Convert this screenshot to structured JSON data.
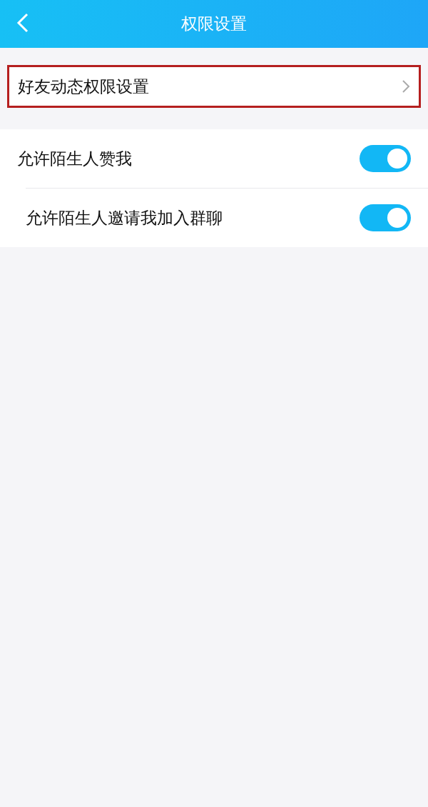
{
  "header": {
    "title": "权限设置"
  },
  "link_row": {
    "label": "好友动态权限设置",
    "highlighted": true
  },
  "toggles": [
    {
      "label": "允许陌生人赞我",
      "on": true
    },
    {
      "label": "允许陌生人邀请我加入群聊",
      "on": true
    }
  ]
}
